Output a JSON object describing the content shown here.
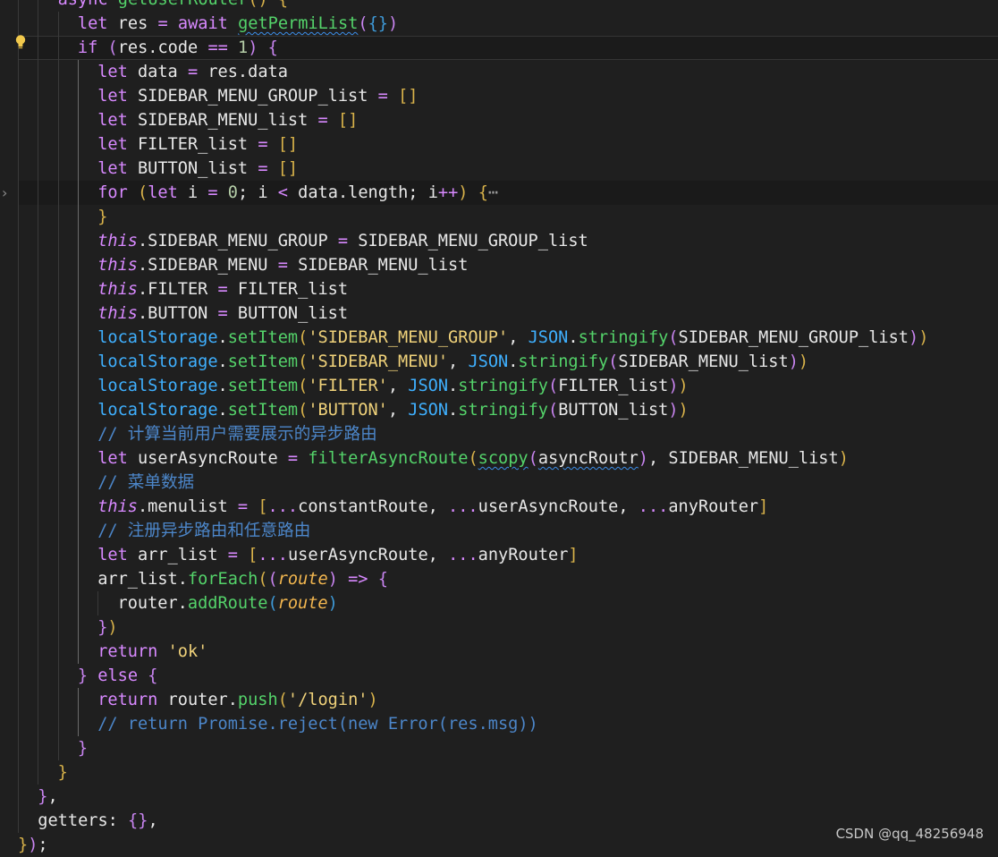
{
  "watermark": "CSDN @qq_48256948",
  "lines": [
    {
      "indent": 2,
      "html": "<span class='kw'>async</span> <span class='fn'>getUserRouter</span><span class='br'>()</span> <span class='br'>{</span>"
    },
    {
      "indent": 3,
      "html": "<span class='kw'>let</span> res <span class='kw'>=</span> <span class='kw'>await</span> <span class='fn squig'>getPermiList</span><span class='br2'>(</span><span class='br3'>{}</span><span class='br2'>)</span>"
    },
    {
      "indent": 3,
      "html": "<span class='kw'>if</span> <span class='br2'>(</span>res.code <span class='kw'>==</span> <span class='num'>1</span><span class='br2'>)</span> <span class='br2'>{</span>",
      "active": true
    },
    {
      "indent": 4,
      "html": "<span class='kw'>let</span> data <span class='kw'>=</span> res.data"
    },
    {
      "indent": 4,
      "html": "<span class='kw'>let</span> SIDEBAR_MENU_GROUP_list <span class='kw'>=</span> <span class='br'>[]</span>"
    },
    {
      "indent": 4,
      "html": "<span class='kw'>let</span> SIDEBAR_MENU_list <span class='kw'>=</span> <span class='br'>[]</span>"
    },
    {
      "indent": 4,
      "html": "<span class='kw'>let</span> FILTER_list <span class='kw'>=</span> <span class='br'>[]</span>"
    },
    {
      "indent": 4,
      "html": "<span class='kw'>let</span> BUTTON_list <span class='kw'>=</span> <span class='br'>[]</span>"
    },
    {
      "indent": 4,
      "html": "<span class='kw'>for</span> <span class='br'>(</span><span class='kw'>let</span> i <span class='kw'>=</span> <span class='num'>0</span>; i <span class='kw'>&lt;</span> data.length; i<span class='kw'>++</span><span class='br'>)</span> <span class='br'>{</span><span class='ell'>⋯</span>",
      "hl": true
    },
    {
      "indent": 4,
      "html": "<span class='br'>}</span>"
    },
    {
      "indent": 4,
      "html": "<span class='this'>this</span>.SIDEBAR_MENU_GROUP <span class='kw'>=</span> SIDEBAR_MENU_GROUP_list"
    },
    {
      "indent": 4,
      "html": "<span class='this'>this</span>.SIDEBAR_MENU <span class='kw'>=</span> SIDEBAR_MENU_list"
    },
    {
      "indent": 4,
      "html": "<span class='this'>this</span>.FILTER <span class='kw'>=</span> FILTER_list"
    },
    {
      "indent": 4,
      "html": "<span class='this'>this</span>.BUTTON <span class='kw'>=</span> BUTTON_list"
    },
    {
      "indent": 4,
      "html": "<span class='obj'>localStorage</span>.<span class='fn'>setItem</span><span class='br'>(</span><span class='str'>'SIDEBAR_MENU_GROUP'</span>, <span class='obj'>JSON</span>.<span class='fn'>stringify</span><span class='br2'>(</span>SIDEBAR_MENU_GROUP_list<span class='br2'>)</span><span class='br'>)</span>"
    },
    {
      "indent": 4,
      "html": "<span class='obj'>localStorage</span>.<span class='fn'>setItem</span><span class='br'>(</span><span class='str'>'SIDEBAR_MENU'</span>, <span class='obj'>JSON</span>.<span class='fn'>stringify</span><span class='br2'>(</span>SIDEBAR_MENU_list<span class='br2'>)</span><span class='br'>)</span>"
    },
    {
      "indent": 4,
      "html": "<span class='obj'>localStorage</span>.<span class='fn'>setItem</span><span class='br'>(</span><span class='str'>'FILTER'</span>, <span class='obj'>JSON</span>.<span class='fn'>stringify</span><span class='br2'>(</span>FILTER_list<span class='br2'>)</span><span class='br'>)</span>"
    },
    {
      "indent": 4,
      "html": "<span class='obj'>localStorage</span>.<span class='fn'>setItem</span><span class='br'>(</span><span class='str'>'BUTTON'</span>, <span class='obj'>JSON</span>.<span class='fn'>stringify</span><span class='br2'>(</span>BUTTON_list<span class='br2'>)</span><span class='br'>)</span>"
    },
    {
      "indent": 4,
      "html": "<span class='com'>// 计算当前用户需要展示的异步路由</span>"
    },
    {
      "indent": 4,
      "html": "<span class='kw'>let</span> userAsyncRoute <span class='kw'>=</span> <span class='fn'>filterAsyncRoute</span><span class='br'>(</span><span class='fn squig'>scopy</span><span class='br2'>(</span><span class='squig'>asyncRoutr</span><span class='br2'>)</span>, SIDEBAR_MENU_list<span class='br'>)</span>"
    },
    {
      "indent": 4,
      "html": "<span class='com'>// 菜单数据</span>"
    },
    {
      "indent": 4,
      "html": "<span class='this'>this</span>.menulist <span class='kw'>=</span> <span class='br'>[</span><span class='kw'>...</span>constantRoute, <span class='kw'>...</span>userAsyncRoute, <span class='kw'>...</span>anyRouter<span class='br'>]</span>"
    },
    {
      "indent": 4,
      "html": "<span class='com'>// 注册异步路由和任意路由</span>"
    },
    {
      "indent": 4,
      "html": "<span class='kw'>let</span> arr_list <span class='kw'>=</span> <span class='br'>[</span><span class='kw'>...</span>userAsyncRoute, <span class='kw'>...</span>anyRouter<span class='br'>]</span>"
    },
    {
      "indent": 4,
      "html": "arr_list.<span class='fn'>forEach</span><span class='br'>(</span><span class='br2'>(</span><span class='param'>route</span><span class='br2'>)</span> <span class='kw'>=&gt;</span> <span class='br2'>{</span>"
    },
    {
      "indent": 5,
      "html": "router.<span class='fn'>addRoute</span><span class='br3'>(</span><span class='param'>route</span><span class='br3'>)</span>"
    },
    {
      "indent": 4,
      "html": "<span class='br2'>}</span><span class='br'>)</span>"
    },
    {
      "indent": 4,
      "html": "<span class='kw'>return</span> <span class='str'>'ok'</span>"
    },
    {
      "indent": 3,
      "html": "<span class='br2'>}</span> <span class='kw'>else</span> <span class='br2'>{</span>"
    },
    {
      "indent": 4,
      "html": "<span class='kw'>return</span> router.<span class='fn'>push</span><span class='br'>(</span><span class='str'>'/login'</span><span class='br'>)</span>"
    },
    {
      "indent": 4,
      "html": "<span class='com'>// return Promise.reject(new Error(res.msg))</span>"
    },
    {
      "indent": 3,
      "html": "<span class='br2'>}</span>"
    },
    {
      "indent": 2,
      "html": "<span class='br'>}</span>"
    },
    {
      "indent": 1,
      "html": "<span class='br2'>}</span>,"
    },
    {
      "indent": 1,
      "html": "getters: <span class='br2'>{}</span>,"
    },
    {
      "indent": 0,
      "html": "<span class='br'>}</span><span class='br2'>)</span>;"
    }
  ]
}
